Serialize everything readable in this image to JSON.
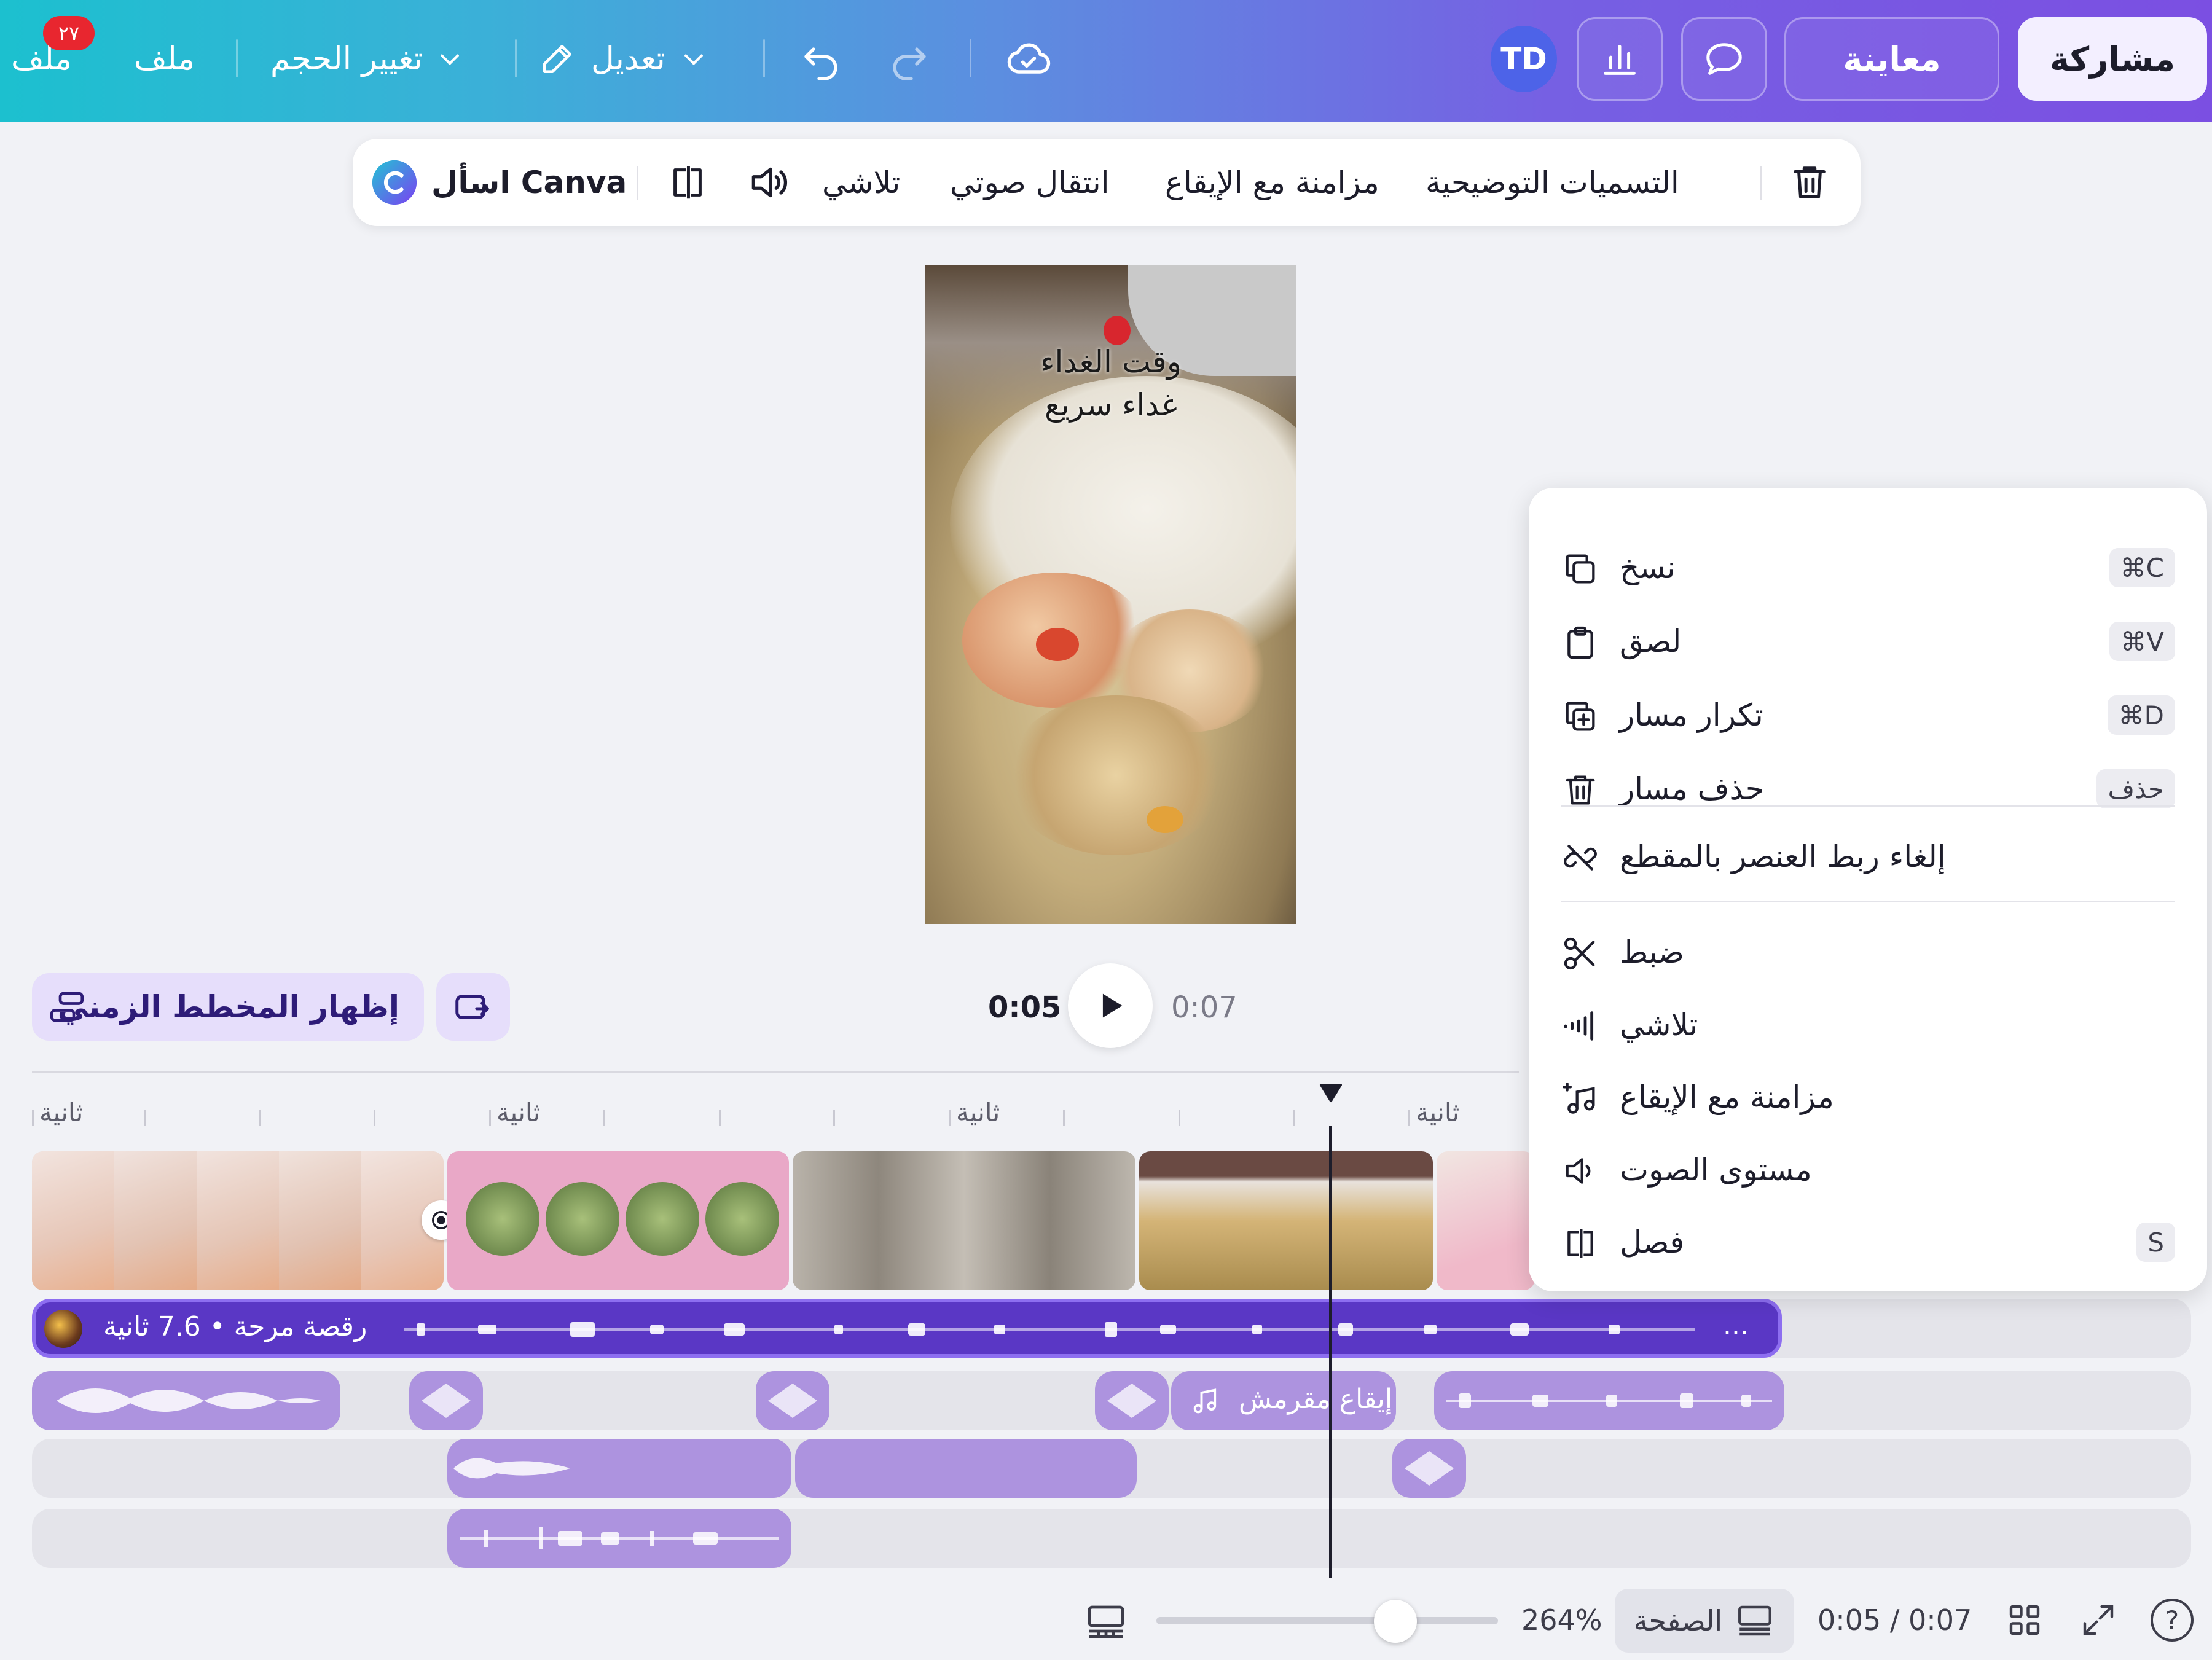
{
  "topbar": {
    "file_menu_label": "ملف",
    "file_menu_label_2": "ملف",
    "notification_count": "٢٧",
    "resize_label": "تغيير الحجم",
    "edit_label": "تعديل",
    "avatar_initials": "TD",
    "preview_label": "معاينة",
    "share_label": "مشاركة"
  },
  "context_toolbar": {
    "ask_canva_label": "اسأل Canva",
    "fade_label": "تلاشي",
    "audio_transition_label": "انتقال صوتي",
    "beat_sync_label": "مزامنة مع الإيقاع",
    "captions_label": "التسميات التوضيحية"
  },
  "video": {
    "caption_line1": "وقت الغداء",
    "caption_line2": "غداء سريع"
  },
  "playback": {
    "current_time": "0:05",
    "total_time": "0:07"
  },
  "timeline": {
    "show_timeline_label": "إظهار المخطط الزمني",
    "ruler_labels": [
      "ثانية",
      "ثانية",
      "ثانية",
      "ثانية"
    ],
    "audio_main_label": "رقصة مرحة • 7.6 ثانية",
    "audio_main_more": "...",
    "clip_label_beat": "إيقاع مقرمش"
  },
  "context_menu": {
    "items": [
      {
        "label": "نسخ",
        "shortcut": "⌘C"
      },
      {
        "label": "لصق",
        "shortcut": "⌘V"
      },
      {
        "label": "تكرار مسار",
        "shortcut": "⌘D"
      },
      {
        "label": "حذف مسار",
        "shortcut": "حذف"
      },
      {
        "label": "إلغاء ربط العنصر بالمقطع",
        "shortcut": ""
      },
      {
        "label": "ضبط",
        "shortcut": ""
      },
      {
        "label": "تلاشي",
        "shortcut": ""
      },
      {
        "label": "مزامنة مع الإيقاع",
        "shortcut": ""
      },
      {
        "label": "مستوى الصوت",
        "shortcut": ""
      },
      {
        "label": "فصل",
        "shortcut": "S"
      }
    ]
  },
  "bottombar": {
    "zoom_percent": "264%",
    "zoom_level": 0.7,
    "page_label": "الصفحة",
    "time_readout": "0:05 / 0:07",
    "help_label": "?"
  },
  "colors": {
    "accent_purple": "#5a37c5",
    "clip_purple": "#ad93df",
    "topbar_start": "#1cc0cf",
    "topbar_end": "#7b4fe2"
  }
}
